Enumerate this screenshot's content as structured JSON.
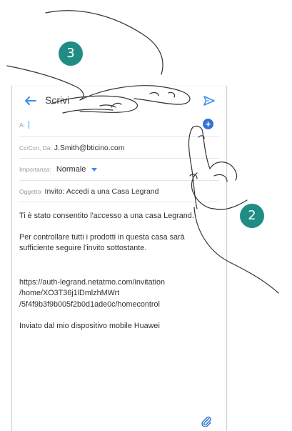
{
  "toolbar": {
    "title": "Scrivi"
  },
  "recipient": {
    "label": "A:",
    "value": ""
  },
  "cc": {
    "label": "Cc/Ccn, Da:",
    "value": "J.Smith@bticino.com"
  },
  "priority": {
    "label": "Importanza:",
    "value": "Normale"
  },
  "subject": {
    "label": "Oggetto:",
    "value": "Invito: Accedi a una Casa Legrand"
  },
  "body": {
    "line1": "Ti è stato consentito l'accesso a una casa Legrand.",
    "line2": "Per controllare tutti i prodotti in questa casa sarà sufficiente seguire l'invito sottostante.",
    "link_part1": "https://auth-legrand.netatmo.com/invitation",
    "link_part2": "/home/XO3T36j1lDmlzhMWrt",
    "link_part3": "/5f4f9b3f9b005f2b0d1ade0c/homecontrol",
    "signature": "Inviato dal mio dispositivo mobile Huawei"
  },
  "steps": {
    "step3": "3",
    "step2": "2"
  },
  "colors": {
    "accent": "#3b8ee8",
    "badge": "#1f8d84"
  },
  "icons": {
    "back": "back-arrow-icon",
    "send": "send-icon",
    "add": "add-contact-icon",
    "attach": "paperclip-icon"
  }
}
